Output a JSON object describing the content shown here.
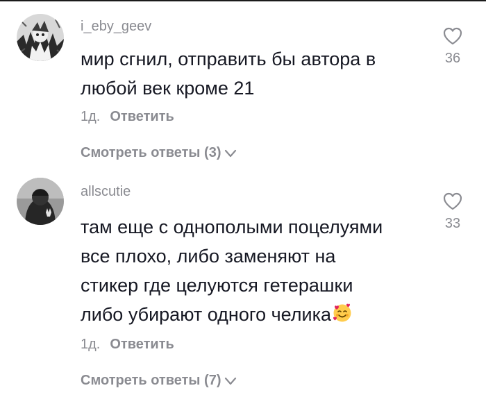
{
  "comments": [
    {
      "username": "i_eby_geev",
      "lines": [
        "мир сгнил, отправить бы автора в",
        "любой век кроме 21"
      ],
      "time": "1д.",
      "reply_label": "Ответить",
      "view_replies": "Смотреть ответы (3)",
      "likes": "36"
    },
    {
      "username": "allscutie",
      "lines": [
        "там еще с однополыми поцелуями",
        "все плохо, либо заменяют на",
        "стикер где целуются гетерашки",
        "либо убирают одного челика"
      ],
      "time": "1д.",
      "reply_label": "Ответить",
      "view_replies": "Смотреть ответы (7)",
      "likes": "33"
    }
  ],
  "icons": {
    "like": "heart-outline-icon",
    "expand": "chevron-down-icon",
    "emoji": "smiling-face-with-hearts-emoji"
  },
  "colors": {
    "text": "#161823",
    "secondary": "#8a8b91"
  }
}
